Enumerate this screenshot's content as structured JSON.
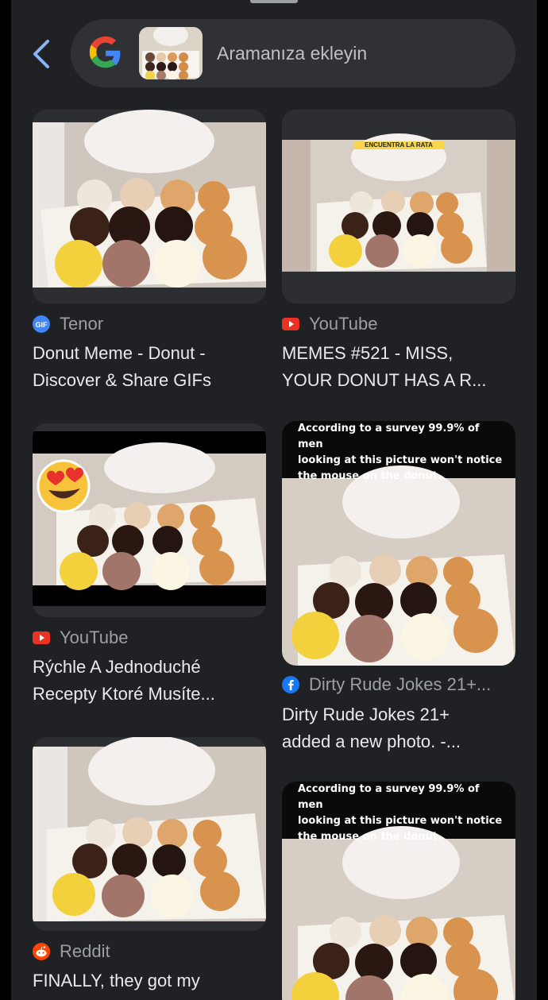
{
  "search": {
    "placeholder": "Aramanıza ekleyin",
    "engine": "Google"
  },
  "colors": {
    "background": "#202124",
    "youtube_red": "#ea3323",
    "reddit_orange": "#ff4500",
    "facebook_blue": "#1877f2",
    "tenor_blue": "#4285f4"
  },
  "results": [
    {
      "source": "Tenor",
      "source_icon": "tenor-gif-icon",
      "title_lines": [
        "Donut Meme - Donut -",
        "Discover & Share GIFs"
      ]
    },
    {
      "source": "YouTube",
      "source_icon": "youtube-icon",
      "banner": "ENCUENTRA LA RATA",
      "title_lines": [
        "MEMES #521 - MISS,",
        "YOUR DONUT HAS A R..."
      ]
    },
    {
      "source": "YouTube",
      "source_icon": "youtube-icon",
      "title_lines": [
        "Rýchle A Jednoduché",
        "Recepty Ktoré Musíte..."
      ]
    },
    {
      "source": "Dirty Rude Jokes 21+...",
      "source_icon": "facebook-icon",
      "overlay_lines": [
        "According to a survey 99.9% of men",
        "looking at this picture won't notice",
        "the mouse on the donut."
      ],
      "title_lines": [
        "Dirty Rude Jokes 21+",
        "added a new photo. -..."
      ]
    },
    {
      "source": "Reddit",
      "source_icon": "reddit-icon",
      "title_lines": [
        "FINALLY, they got my"
      ]
    },
    {
      "overlay_lines": [
        "According to a survey 99.9% of men",
        "looking at this picture won't notice",
        "the mouse on the donut."
      ]
    }
  ]
}
